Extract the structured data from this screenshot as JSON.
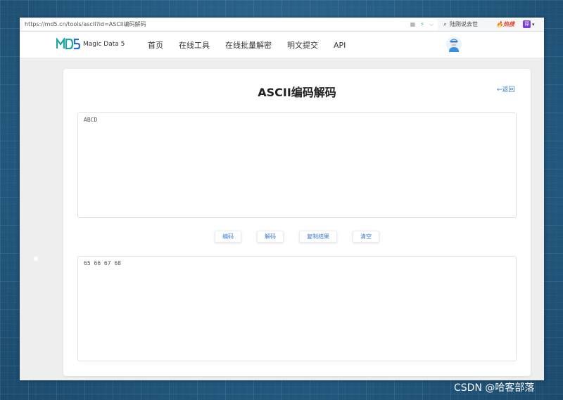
{
  "browser": {
    "url": "https://md5.cn/tools/ascII?id=ASCII编码解码",
    "search_placeholder": "陆刚说去世",
    "hot_label": "热搜",
    "extension_label": "译"
  },
  "site": {
    "logo_text": "Magic Data 5",
    "nav": [
      "首页",
      "在线工具",
      "在线批量解密",
      "明文提交",
      "API"
    ]
  },
  "tool": {
    "title": "ASCII编码解码",
    "back_label": "←返回",
    "input_value": "ABCD",
    "output_value": "65 66 67 68",
    "buttons": {
      "encode": "编码",
      "decode": "解码",
      "copy": "复制结果",
      "clear": "清空"
    }
  },
  "watermark": "CSDN @哈客部落",
  "colors": {
    "accent": "#3a7bd5",
    "logo_teal": "#1fa5a0",
    "hot_red": "#e8462e"
  }
}
